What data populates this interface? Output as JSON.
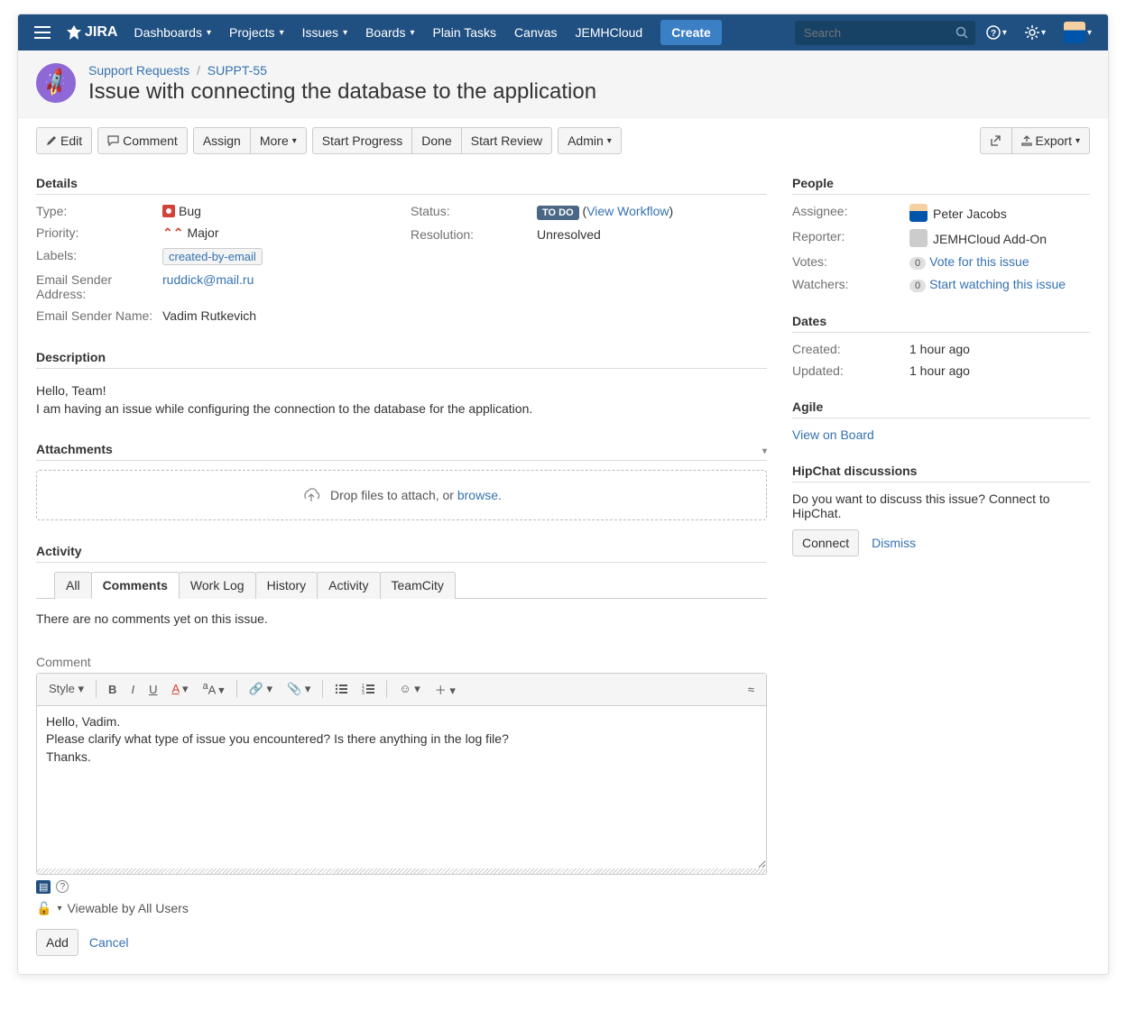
{
  "nav": {
    "logo": "JIRA",
    "items": [
      {
        "label": "Dashboards",
        "dropdown": true
      },
      {
        "label": "Projects",
        "dropdown": true
      },
      {
        "label": "Issues",
        "dropdown": true
      },
      {
        "label": "Boards",
        "dropdown": true
      },
      {
        "label": "Plain Tasks",
        "dropdown": false
      },
      {
        "label": "Canvas",
        "dropdown": false
      },
      {
        "label": "JEMHCloud",
        "dropdown": false
      }
    ],
    "create": "Create",
    "search_placeholder": "Search"
  },
  "breadcrumb": {
    "project": "Support Requests",
    "key": "SUPPT-55"
  },
  "title": "Issue with connecting the database to the application",
  "toolbar": {
    "edit": "Edit",
    "comment": "Comment",
    "assign": "Assign",
    "more": "More",
    "start_progress": "Start Progress",
    "done": "Done",
    "start_review": "Start Review",
    "admin": "Admin",
    "export": "Export"
  },
  "details": {
    "heading": "Details",
    "type_label": "Type:",
    "type_value": "Bug",
    "priority_label": "Priority:",
    "priority_value": "Major",
    "labels_label": "Labels:",
    "labels_value": "created-by-email",
    "status_label": "Status:",
    "status_value": "TO DO",
    "view_workflow": "View Workflow",
    "resolution_label": "Resolution:",
    "resolution_value": "Unresolved",
    "email_sender_addr_label": "Email Sender Address:",
    "email_sender_addr_value": "ruddick@mail.ru",
    "email_sender_name_label": "Email Sender Name:",
    "email_sender_name_value": "Vadim Rutkevich"
  },
  "description": {
    "heading": "Description",
    "line1": "Hello, Team!",
    "line2": "I am having an issue while configuring the connection to the database for the application."
  },
  "attachments": {
    "heading": "Attachments",
    "drop_prefix": "Drop files to attach, or ",
    "browse": "browse",
    "drop_suffix": "."
  },
  "activity": {
    "heading": "Activity",
    "tabs": [
      "All",
      "Comments",
      "Work Log",
      "History",
      "Activity",
      "TeamCity"
    ],
    "active_tab": "Comments",
    "no_comments": "There are no comments yet on this issue."
  },
  "comment_form": {
    "label": "Comment",
    "style": "Style",
    "body": "Hello, Vadim.\nPlease clarify what type of issue you encountered? Is there anything in the log file?\nThanks.",
    "viewable": "Viewable by All Users",
    "add": "Add",
    "cancel": "Cancel"
  },
  "people": {
    "heading": "People",
    "assignee_label": "Assignee:",
    "assignee_value": "Peter Jacobs",
    "reporter_label": "Reporter:",
    "reporter_value": "JEMHCloud Add-On",
    "votes_label": "Votes:",
    "votes_count": "0",
    "votes_link": "Vote for this issue",
    "watchers_label": "Watchers:",
    "watchers_count": "0",
    "watchers_link": "Start watching this issue"
  },
  "dates": {
    "heading": "Dates",
    "created_label": "Created:",
    "created_value": "1 hour ago",
    "updated_label": "Updated:",
    "updated_value": "1 hour ago"
  },
  "agile": {
    "heading": "Agile",
    "view_on_board": "View on Board"
  },
  "hipchat": {
    "heading": "HipChat discussions",
    "text": "Do you want to discuss this issue? Connect to HipChat.",
    "connect": "Connect",
    "dismiss": "Dismiss"
  }
}
